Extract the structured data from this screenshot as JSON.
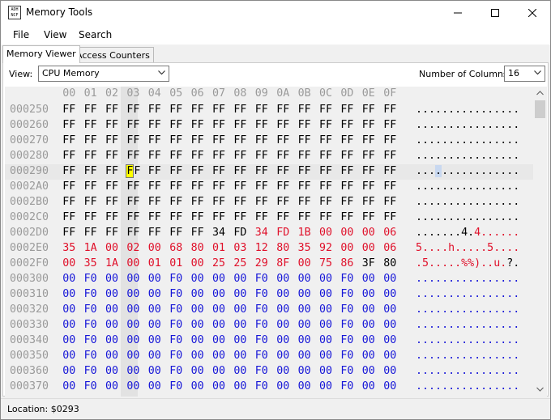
{
  "window": {
    "title": "Memory Tools",
    "icon_lines": [
      "ADH",
      "NCF"
    ],
    "minimize_icon": "minimize-icon",
    "maximize_icon": "maximize-icon",
    "close_icon": "close-icon"
  },
  "menu": [
    "File",
    "View",
    "Search"
  ],
  "tabs": [
    "Memory Viewer",
    "Access Counters"
  ],
  "toolbar": {
    "view_label": "View:",
    "view_value": "CPU Memory",
    "columns_label": "Number of Columns:",
    "columns_value": "16"
  },
  "header_cols": [
    "00",
    "01",
    "02",
    "03",
    "04",
    "05",
    "06",
    "07",
    "08",
    "09",
    "0A",
    "0B",
    "0C",
    "0D",
    "0E",
    "0F"
  ],
  "colors": {
    "default": "#000000",
    "changed": "#e0102a",
    "zero": "#1616d8",
    "address": "#9a9a9a"
  },
  "selected_column": "03",
  "selected": {
    "address": "000290",
    "column": 3,
    "byte_display": "F"
  },
  "rows": [
    {
      "addr": "000250",
      "bytes": [
        "FF",
        "FF",
        "FF",
        "FF",
        "FF",
        "FF",
        "FF",
        "FF",
        "FF",
        "FF",
        "FF",
        "FF",
        "FF",
        "FF",
        "FF",
        "FF"
      ],
      "colors": "kkkkkkkkkkkkkkkk",
      "ascii": "................"
    },
    {
      "addr": "000260",
      "bytes": [
        "FF",
        "FF",
        "FF",
        "FF",
        "FF",
        "FF",
        "FF",
        "FF",
        "FF",
        "FF",
        "FF",
        "FF",
        "FF",
        "FF",
        "FF",
        "FF"
      ],
      "colors": "kkkkkkkkkkkkkkkk",
      "ascii": "................"
    },
    {
      "addr": "000270",
      "bytes": [
        "FF",
        "FF",
        "FF",
        "FF",
        "FF",
        "FF",
        "FF",
        "FF",
        "FF",
        "FF",
        "FF",
        "FF",
        "FF",
        "FF",
        "FF",
        "FF"
      ],
      "colors": "kkkkkkkkkkkkkkkk",
      "ascii": "................"
    },
    {
      "addr": "000280",
      "bytes": [
        "FF",
        "FF",
        "FF",
        "FF",
        "FF",
        "FF",
        "FF",
        "FF",
        "FF",
        "FF",
        "FF",
        "FF",
        "FF",
        "FF",
        "FF",
        "FF"
      ],
      "colors": "kkkkkkkkkkkkkkkk",
      "ascii": "................"
    },
    {
      "addr": "000290",
      "bytes": [
        "FF",
        "FF",
        "FF",
        "FF",
        "FF",
        "FF",
        "FF",
        "FF",
        "FF",
        "FF",
        "FF",
        "FF",
        "FF",
        "FF",
        "FF",
        "FF"
      ],
      "colors": "kkkkkkkkkkkkkkkk",
      "ascii": "................"
    },
    {
      "addr": "0002A0",
      "bytes": [
        "FF",
        "FF",
        "FF",
        "FF",
        "FF",
        "FF",
        "FF",
        "FF",
        "FF",
        "FF",
        "FF",
        "FF",
        "FF",
        "FF",
        "FF",
        "FF"
      ],
      "colors": "kkkkkkkkkkkkkkkk",
      "ascii": "................"
    },
    {
      "addr": "0002B0",
      "bytes": [
        "FF",
        "FF",
        "FF",
        "FF",
        "FF",
        "FF",
        "FF",
        "FF",
        "FF",
        "FF",
        "FF",
        "FF",
        "FF",
        "FF",
        "FF",
        "FF"
      ],
      "colors": "kkkkkkkkkkkkkkkk",
      "ascii": "................"
    },
    {
      "addr": "0002C0",
      "bytes": [
        "FF",
        "FF",
        "FF",
        "FF",
        "FF",
        "FF",
        "FF",
        "FF",
        "FF",
        "FF",
        "FF",
        "FF",
        "FF",
        "FF",
        "FF",
        "FF"
      ],
      "colors": "kkkkkkkkkkkkkkkk",
      "ascii": "................"
    },
    {
      "addr": "0002D0",
      "bytes": [
        "FF",
        "FF",
        "FF",
        "FF",
        "FF",
        "FF",
        "FF",
        "34",
        "FD",
        "34",
        "FD",
        "1B",
        "00",
        "00",
        "00",
        "06"
      ],
      "colors": "kkkkkkkkkrrrrrrr",
      "ascii": ".......4.4......"
    },
    {
      "addr": "0002E0",
      "bytes": [
        "35",
        "1A",
        "00",
        "02",
        "00",
        "68",
        "80",
        "01",
        "03",
        "12",
        "80",
        "35",
        "92",
        "00",
        "00",
        "06"
      ],
      "colors": "rrrrrrrrrrrrrrrr",
      "ascii": "5....h.....5...."
    },
    {
      "addr": "0002F0",
      "bytes": [
        "00",
        "35",
        "1A",
        "00",
        "01",
        "01",
        "00",
        "25",
        "25",
        "29",
        "8F",
        "00",
        "75",
        "86",
        "3F",
        "80"
      ],
      "colors": "rrrrrrrrrrrrrrkk",
      "ascii": ".5.....%%)..u.?."
    },
    {
      "addr": "000300",
      "bytes": [
        "00",
        "F0",
        "00",
        "00",
        "00",
        "F0",
        "00",
        "00",
        "00",
        "F0",
        "00",
        "00",
        "00",
        "F0",
        "00",
        "00"
      ],
      "colors": "bbbbbbbbbbbbbbbb",
      "ascii": "................"
    },
    {
      "addr": "000310",
      "bytes": [
        "00",
        "F0",
        "00",
        "00",
        "00",
        "F0",
        "00",
        "00",
        "00",
        "F0",
        "00",
        "00",
        "00",
        "F0",
        "00",
        "00"
      ],
      "colors": "bbbbbbbbbbbbbbbb",
      "ascii": "................"
    },
    {
      "addr": "000320",
      "bytes": [
        "00",
        "F0",
        "00",
        "00",
        "00",
        "F0",
        "00",
        "00",
        "00",
        "F0",
        "00",
        "00",
        "00",
        "F0",
        "00",
        "00"
      ],
      "colors": "bbbbbbbbbbbbbbbb",
      "ascii": "................"
    },
    {
      "addr": "000330",
      "bytes": [
        "00",
        "F0",
        "00",
        "00",
        "00",
        "F0",
        "00",
        "00",
        "00",
        "F0",
        "00",
        "00",
        "00",
        "F0",
        "00",
        "00"
      ],
      "colors": "bbbbbbbbbbbbbbbb",
      "ascii": "................"
    },
    {
      "addr": "000340",
      "bytes": [
        "00",
        "F0",
        "00",
        "00",
        "00",
        "F0",
        "00",
        "00",
        "00",
        "F0",
        "00",
        "00",
        "00",
        "F0",
        "00",
        "00"
      ],
      "colors": "bbbbbbbbbbbbbbbb",
      "ascii": "................"
    },
    {
      "addr": "000350",
      "bytes": [
        "00",
        "F0",
        "00",
        "00",
        "00",
        "F0",
        "00",
        "00",
        "00",
        "F0",
        "00",
        "00",
        "00",
        "F0",
        "00",
        "00"
      ],
      "colors": "bbbbbbbbbbbbbbbb",
      "ascii": "................"
    },
    {
      "addr": "000360",
      "bytes": [
        "00",
        "F0",
        "00",
        "00",
        "00",
        "F0",
        "00",
        "00",
        "00",
        "F0",
        "00",
        "00",
        "00",
        "F0",
        "00",
        "00"
      ],
      "colors": "bbbbbbbbbbbbbbbb",
      "ascii": "................"
    },
    {
      "addr": "000370",
      "bytes": [
        "00",
        "F0",
        "00",
        "00",
        "00",
        "F0",
        "00",
        "00",
        "00",
        "F0",
        "00",
        "00",
        "00",
        "F0",
        "00",
        "00"
      ],
      "colors": "bbbbbbbbbbbbbbbb",
      "ascii": "................"
    }
  ],
  "status": {
    "location": "Location: $0293"
  }
}
